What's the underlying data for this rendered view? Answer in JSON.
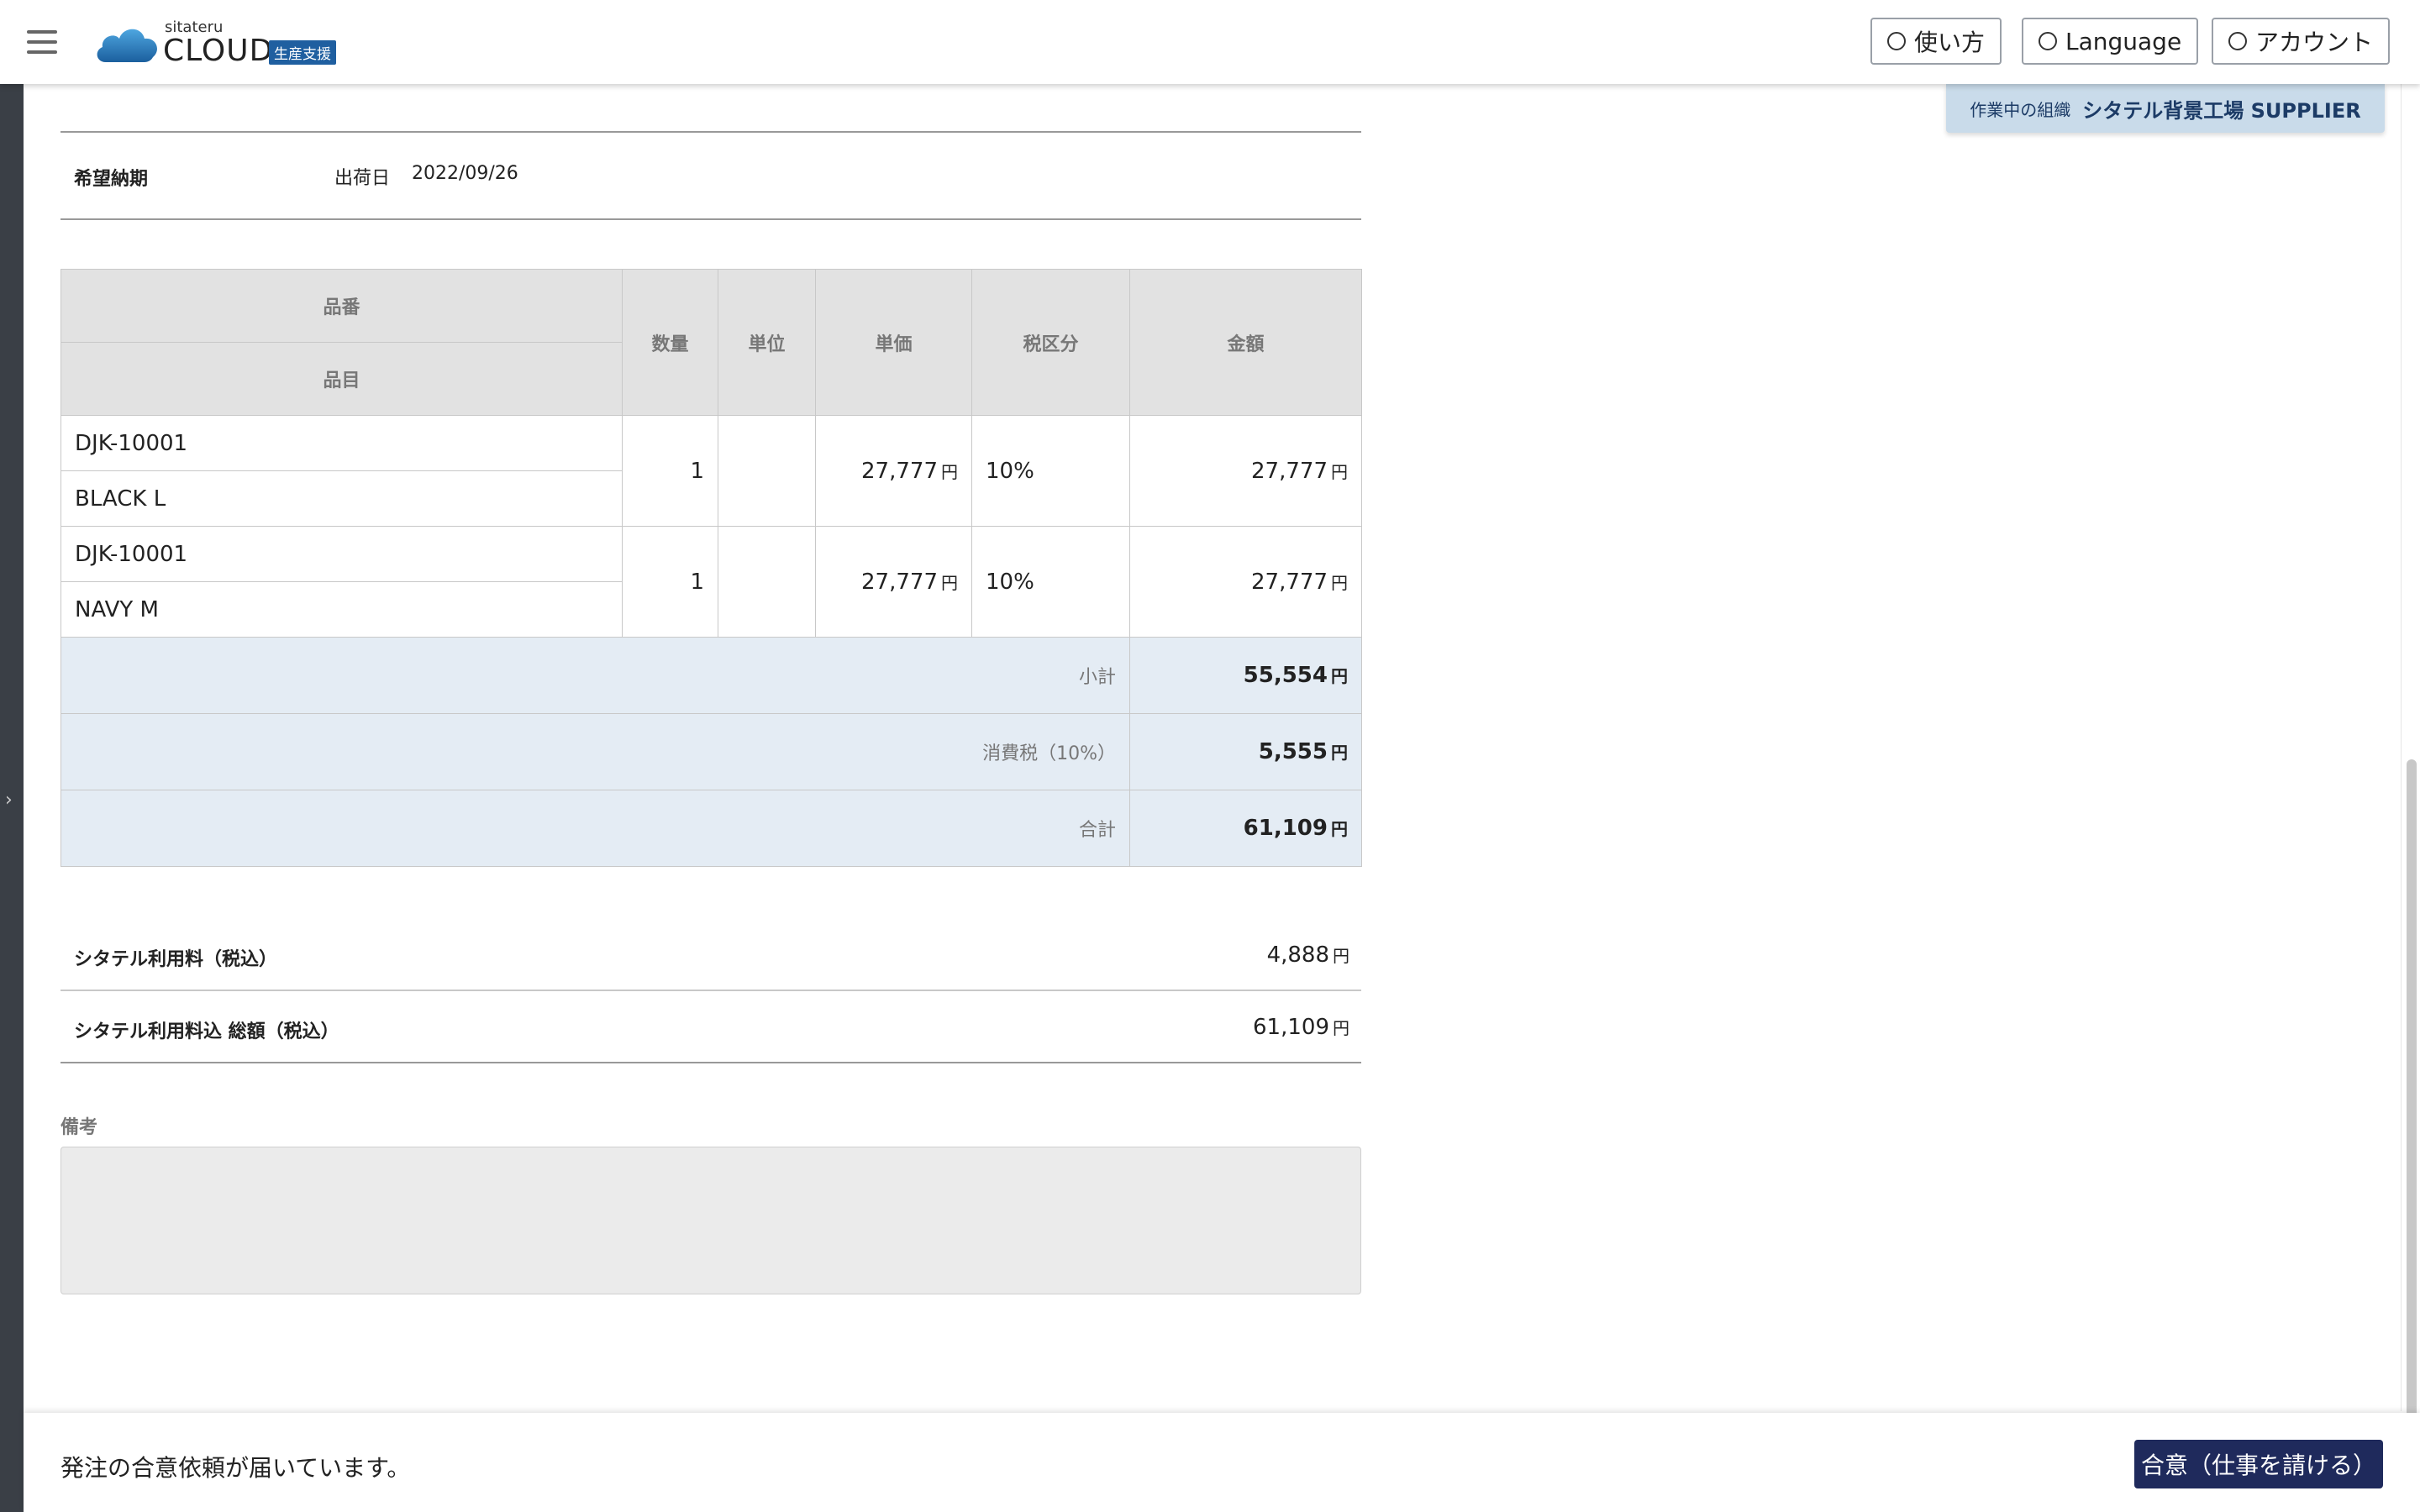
{
  "header": {
    "logo_small": "sitateru",
    "logo_main": "CLOUD",
    "logo_badge": "生産支援",
    "buttons": {
      "help": "使い方",
      "language": "Language",
      "account": "アカウント"
    }
  },
  "org": {
    "label": "作業中の組織",
    "name": "シタテル背景工場 SUPPLIER"
  },
  "delivery": {
    "label": "希望納期",
    "sub_label": "出荷日",
    "date": "2022/09/26"
  },
  "table": {
    "headers": {
      "part_no": "品番",
      "item": "品目",
      "qty": "数量",
      "unit": "単位",
      "unit_price": "単価",
      "tax": "税区分",
      "amount": "金額"
    },
    "rows": [
      {
        "part_no": "DJK-10001",
        "item": "BLACK L",
        "qty": "1",
        "unit": "",
        "unit_price": "27,777",
        "tax": "10%",
        "amount": "27,777"
      },
      {
        "part_no": "DJK-10001",
        "item": "NAVY M",
        "qty": "1",
        "unit": "",
        "unit_price": "27,777",
        "tax": "10%",
        "amount": "27,777"
      }
    ],
    "currency": "円",
    "subtotal_label": "小計",
    "subtotal": "55,554",
    "tax_label": "消費税（10%）",
    "tax_value": "5,555",
    "total_label": "合計",
    "total": "61,109"
  },
  "fees": {
    "usage_label": "シタテル利用料（税込）",
    "usage_value": "4,888",
    "grand_label": "シタテル利用料込 総額（税込）",
    "grand_value": "61,109"
  },
  "remarks": {
    "label": "備考"
  },
  "footer": {
    "message": "発注の合意依頼が届いています。",
    "agree_button": "合意（仕事を請ける）"
  }
}
